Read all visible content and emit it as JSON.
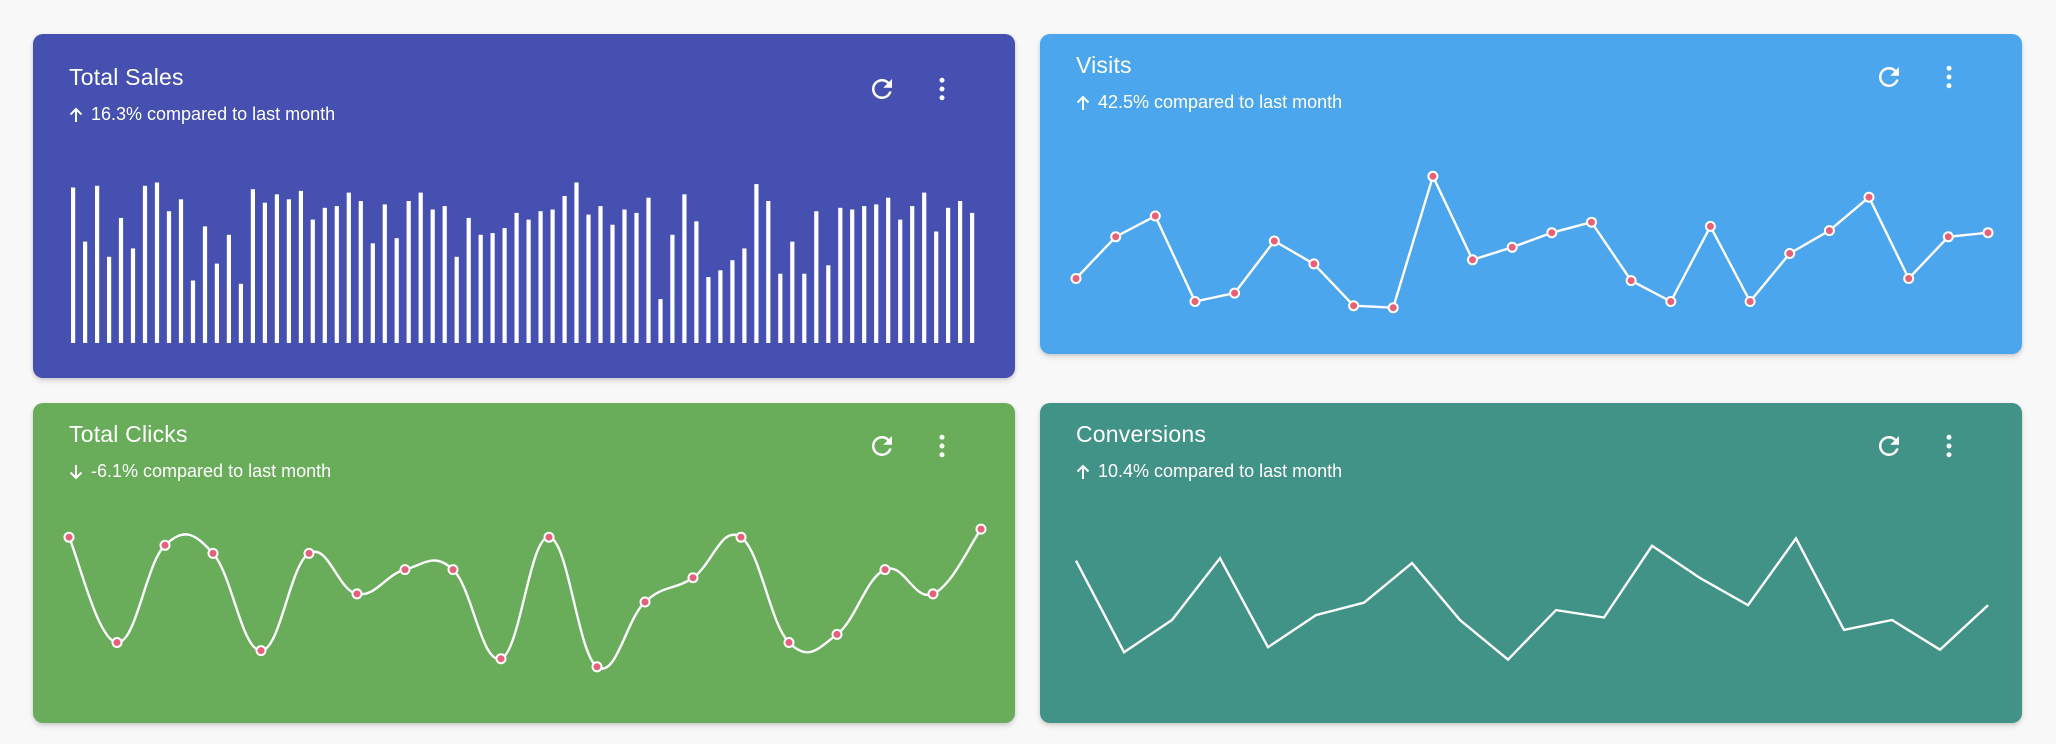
{
  "colors": {
    "sales_bg": "#4550b0",
    "visits_bg": "#4ca6ed",
    "clicks_bg": "#69ad5b",
    "conversions_bg": "#429387",
    "line": "#ffffff",
    "marker_fill": "#e8617a",
    "marker_stroke": "#ffffff"
  },
  "cards": {
    "sales": {
      "title": "Total Sales",
      "change": "16.3% compared to last month",
      "trend": "up",
      "icons": [
        "arrow-up-icon",
        "refresh-icon",
        "more-vert-icon"
      ],
      "chart_data": {
        "type": "bar",
        "values": [
          92,
          60,
          93,
          51,
          74,
          56,
          93,
          95,
          78,
          85,
          37,
          69,
          47,
          64,
          35,
          91,
          83,
          88,
          85,
          90,
          73,
          80,
          81,
          89,
          84,
          59,
          82,
          62,
          84,
          89,
          79,
          81,
          51,
          74,
          64,
          65,
          68,
          77,
          73,
          78,
          79,
          87,
          95,
          76,
          81,
          70,
          79,
          77,
          86,
          26,
          64,
          88,
          72,
          39,
          43,
          49,
          56,
          94,
          84,
          41,
          60,
          41,
          78,
          46,
          80,
          79,
          81,
          82,
          86,
          73,
          81,
          89,
          66,
          80,
          84,
          77
        ]
      }
    },
    "visits": {
      "title": "Visits",
      "change": "42.5% compared to last month",
      "trend": "up",
      "icons": [
        "arrow-up-icon",
        "refresh-icon",
        "more-vert-icon"
      ],
      "chart_data": {
        "type": "line",
        "values": [
          27,
          47,
          57,
          16,
          20,
          45,
          34,
          14,
          13,
          76,
          36,
          42,
          49,
          54,
          26,
          16,
          52,
          16,
          39,
          50,
          66,
          27,
          47,
          49
        ]
      }
    },
    "clicks": {
      "title": "Total Clicks",
      "change": "-6.1% compared to last month",
      "trend": "down",
      "icons": [
        "arrow-down-icon",
        "refresh-icon",
        "more-vert-icon"
      ],
      "chart_data": {
        "type": "line",
        "values": [
          40,
          27,
          39,
          38,
          26,
          38,
          33,
          36,
          36,
          25,
          40,
          24,
          32,
          35,
          40,
          27,
          28,
          36,
          33,
          41
        ]
      }
    },
    "conversions": {
      "title": "Conversions",
      "change": "10.4% compared to last month",
      "trend": "up",
      "icons": [
        "arrow-up-icon",
        "refresh-icon",
        "more-vert-icon"
      ],
      "chart_data": {
        "type": "line",
        "values": [
          58,
          21,
          34,
          59,
          23,
          36,
          41,
          57,
          34,
          18,
          38,
          35,
          64,
          51,
          40,
          67,
          30,
          34,
          22,
          40
        ]
      }
    }
  }
}
